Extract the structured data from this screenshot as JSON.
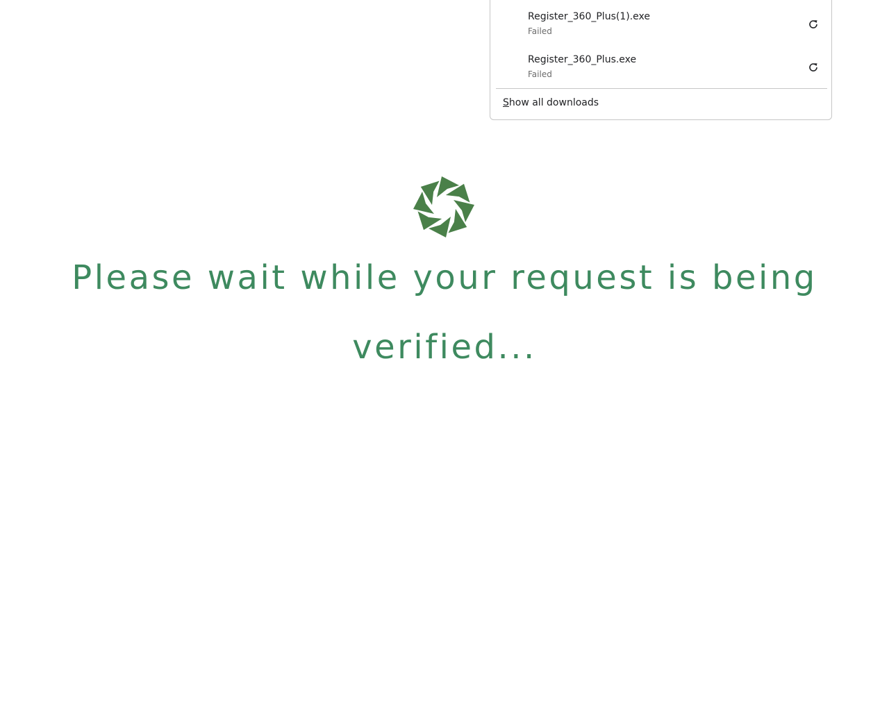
{
  "downloads": {
    "items": [
      {
        "file_name": "Register_360_Plus(1).exe",
        "status": "Failed",
        "action_icon": "retry-icon"
      },
      {
        "file_name": "Register_360_Plus.exe",
        "status": "Failed",
        "action_icon": "retry-icon"
      }
    ],
    "show_all": {
      "mnemonic": "S",
      "rest": "how all downloads"
    }
  },
  "main": {
    "logo_icon": "spinner-logo-icon",
    "message": "Please wait while your request is being verified..."
  },
  "colors": {
    "message": "#3e8a5f",
    "logo": "#4a8049"
  }
}
